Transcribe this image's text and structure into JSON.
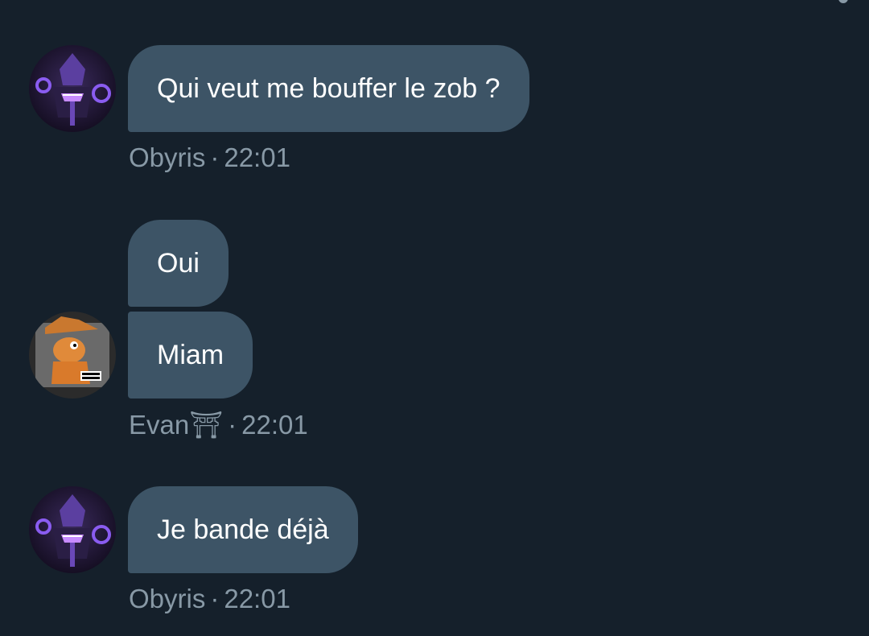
{
  "messages": [
    {
      "sender": "Obyris",
      "time": "22:01",
      "bubbles": [
        "Qui veut me bouffer le zob ?"
      ],
      "avatar_icon": "purple-helmet-avatar-icon"
    },
    {
      "sender": "Evan⛩",
      "time": "22:01",
      "bubbles": [
        "Oui",
        "Miam"
      ],
      "avatar_icon": "cartoon-character-avatar-icon"
    },
    {
      "sender": "Obyris",
      "time": "22:01",
      "bubbles": [
        "Je bande déjà"
      ],
      "avatar_icon": "purple-helmet-avatar-icon"
    }
  ],
  "separator": "·",
  "colors": {
    "background": "#15202b",
    "bubble": "#3d5466",
    "meta_text": "#8899a6",
    "bubble_text": "#ffffff"
  }
}
